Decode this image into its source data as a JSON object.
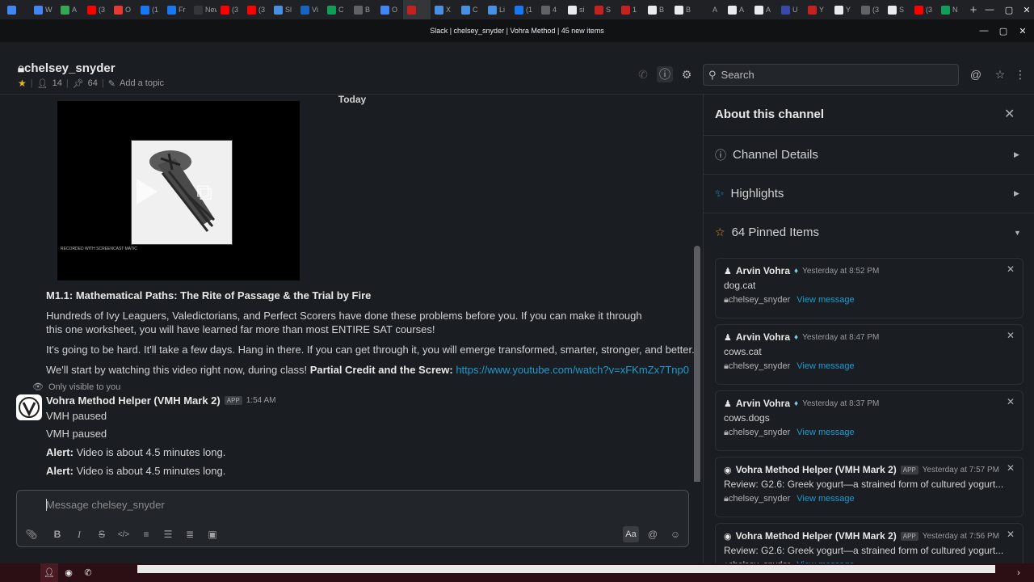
{
  "browser": {
    "tabs": [
      {
        "label": "",
        "color": "#4285f4"
      },
      {
        "label": "W",
        "color": "#4285f4"
      },
      {
        "label": "A",
        "color": "#34a853"
      },
      {
        "label": "(3",
        "color": "#ff0000"
      },
      {
        "label": "O",
        "color": "#e53935"
      },
      {
        "label": "(1",
        "color": "#1877f2"
      },
      {
        "label": "Fr",
        "color": "#1877f2"
      },
      {
        "label": "New",
        "color": "#35363a"
      },
      {
        "label": "(3",
        "color": "#ff0000"
      },
      {
        "label": "(3",
        "color": "#ff0000"
      },
      {
        "label": "Sl",
        "color": "#4a90e2"
      },
      {
        "label": "Vi",
        "color": "#1565c0"
      },
      {
        "label": "C",
        "color": "#0f9d58"
      },
      {
        "label": "B",
        "color": "#5f6368"
      },
      {
        "label": "O",
        "color": "#4285f4"
      },
      {
        "label": "",
        "color": "#c5221f"
      },
      {
        "label": "X",
        "color": "#4a90e2"
      },
      {
        "label": "C",
        "color": "#4a90e2"
      },
      {
        "label": "Li",
        "color": "#4a90e2"
      },
      {
        "label": "(1",
        "color": "#1877f2"
      },
      {
        "label": "4",
        "color": "#5f6368"
      },
      {
        "label": "si",
        "color": "#e8eaed"
      },
      {
        "label": "S",
        "color": "#c5221f"
      },
      {
        "label": "1",
        "color": "#c5221f"
      },
      {
        "label": "B",
        "color": "#e8eaed"
      },
      {
        "label": "B",
        "color": "#e8eaed"
      },
      {
        "label": "A",
        "color": "#202124"
      },
      {
        "label": "A",
        "color": "#e8eaed"
      },
      {
        "label": "A",
        "color": "#e8eaed"
      },
      {
        "label": "U",
        "color": "#3949ab"
      },
      {
        "label": "Y",
        "color": "#c5221f"
      },
      {
        "label": "Y",
        "color": "#e8eaed"
      },
      {
        "label": "(3",
        "color": "#5f6368"
      },
      {
        "label": "S",
        "color": "#e8eaed"
      },
      {
        "label": "(3",
        "color": "#ff0000"
      },
      {
        "label": "N",
        "color": "#0f9d58"
      }
    ],
    "active_tab_index": 15,
    "new_tab": "+",
    "window_title": "Slack | chelsey_snyder | Vohra Method | 45 new items"
  },
  "header": {
    "channel_name": "chelsey_snyder",
    "members": "14",
    "pins": "64",
    "add_topic": "Add a topic",
    "search_placeholder": "Search"
  },
  "messages": {
    "day_divider": "Today",
    "lesson_title": "M1.1: Mathematical Paths: The Rite of Passage & the Trial by Fire",
    "para1": "Hundreds of Ivy Leaguers, Valedictorians, and Perfect Scorers have done these problems before you. If you can make it through this one worksheet, you will have learned far more than most ENTIRE SAT courses!",
    "para2": "It's going to be hard. It'll take a few days. Hang in there. If you can get through it, you will emerge transformed, smarter, stronger, and better.",
    "para3_prefix": "We'll start by watching this video right now, during class!",
    "para3_bold": "Partial Credit and the Screw:",
    "para3_link": "https://www.youtube.com/watch?v=xFKmZx7Tnp0",
    "video_watermark": "RECORDED WITH SCREENCAST MATIC",
    "only_visible": "Only visible to you",
    "bot_name": "Vohra Method Helper (VMH Mark 2)",
    "bot_badge": "APP",
    "bot_time": "1:54 AM",
    "bot_lines": [
      "VMH paused",
      "VMH paused"
    ],
    "alert_label": "Alert:",
    "alert_text": "Video is about 4.5 minutes long."
  },
  "composer": {
    "placeholder": "Message chelsey_snyder",
    "aa": "Aa"
  },
  "sidebar": {
    "title": "About this channel",
    "sections": [
      "Channel Details",
      "Highlights",
      "64 Pinned Items"
    ],
    "view_message": "View message",
    "pins": [
      {
        "author": "Arvin Vohra",
        "time": "Yesterday at 8:52 PM",
        "text": "dog.cat",
        "channel": "chelsey_snyder"
      },
      {
        "author": "Arvin Vohra",
        "time": "Yesterday at 8:47 PM",
        "text": "cows.cat",
        "channel": "chelsey_snyder"
      },
      {
        "author": "Arvin Vohra",
        "time": "Yesterday at 8:37 PM",
        "text": "cows.dogs",
        "channel": "chelsey_snyder"
      },
      {
        "author": "Vohra Method Helper (VMH Mark 2)",
        "badge": "APP",
        "time": "Yesterday at 7:57 PM",
        "text": "Review:  G2.6: Greek yogurt—a strained form of cultured yogurt...",
        "channel": "chelsey_snyder"
      },
      {
        "author": "Vohra Method Helper (VMH Mark 2)",
        "badge": "APP",
        "time": "Yesterday at 7:56 PM",
        "text": "Review:  G2.6: Greek yogurt—a strained form of cultured yogurt...",
        "channel": "chelsey_snyder"
      }
    ]
  },
  "colors": {
    "link": "#1d9bd1",
    "star": "#e8b71f",
    "background": "#1a1d21"
  }
}
